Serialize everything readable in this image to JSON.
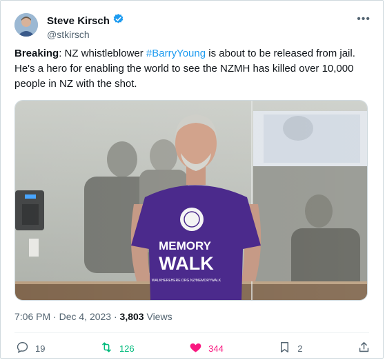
{
  "author": {
    "name": "Steve Kirsch",
    "handle": "@stkirsch"
  },
  "more_label": "•••",
  "tweet": {
    "lead": "Breaking",
    "text_before": ": NZ whistleblower ",
    "hashtag": "#BarryYoung",
    "text_after": " is about to be released from jail. He's a hero for enabling the world to see the NZMH has killed over 10,000 people in NZ with the shot."
  },
  "photo": {
    "shirt_line1": "MEMORY",
    "shirt_line2": "WALK",
    "shirt_url": "WALKHEREHERE.ORG.NZ/MEMORYWALK"
  },
  "meta": {
    "time": "7:06 PM",
    "sep1": " · ",
    "date": "Dec 4, 2023",
    "sep2": " · ",
    "views_count": "3,803",
    "views_label": " Views"
  },
  "actions": {
    "replies": "19",
    "retweets": "126",
    "likes": "344",
    "bookmarks": "2"
  },
  "colors": {
    "link": "#1d9bf0",
    "retweet": "#00ba7c",
    "like": "#f91880",
    "secondary": "#536471",
    "shirt": "#4b2a8c"
  }
}
